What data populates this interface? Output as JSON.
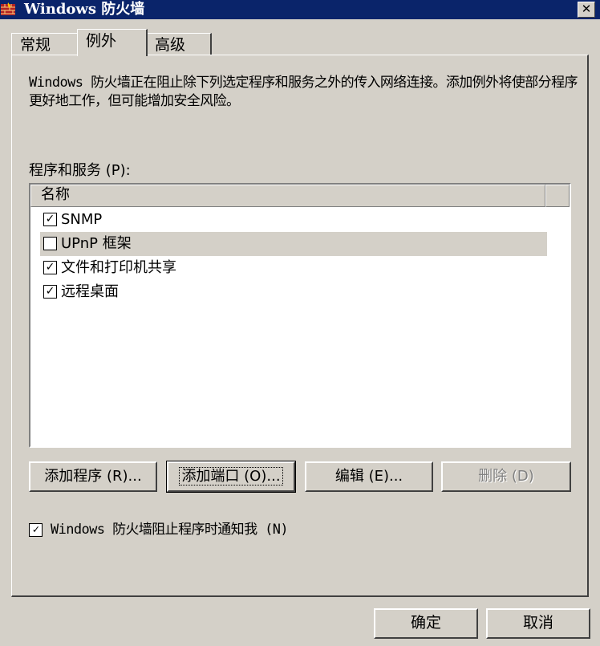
{
  "window": {
    "title": "Windows 防火墙",
    "close_glyph": "✕",
    "icon": "firewall-icon"
  },
  "tabs": [
    {
      "label": "常规",
      "active": false
    },
    {
      "label": "例外",
      "active": true
    },
    {
      "label": "高级",
      "active": false
    }
  ],
  "exceptions": {
    "description": "Windows 防火墙正在阻止除下列选定程序和服务之外的传入网络连接。添加例外将使部分程序更好地工作，但可能增加安全风险。",
    "list_label": "程序和服务 (P):",
    "column_header": "名称",
    "items": [
      {
        "label": "SNMP",
        "checked": true,
        "check_glyph": "✓",
        "selected": false
      },
      {
        "label": "UPnP 框架",
        "checked": false,
        "check_glyph": "",
        "selected": true
      },
      {
        "label": "文件和打印机共享",
        "checked": true,
        "check_glyph": "✓",
        "selected": false
      },
      {
        "label": "远程桌面",
        "checked": true,
        "check_glyph": "✓",
        "selected": false
      }
    ],
    "buttons": {
      "add_program": "添加程序 (R)...",
      "add_port": "添加端口 (O)...",
      "edit": "编辑 (E)...",
      "delete": "删除 (D)"
    },
    "notify_label": "Windows 防火墙阻止程序时通知我 (N)",
    "notify_checked": true,
    "notify_glyph": "✓"
  },
  "footer": {
    "ok": "确定",
    "cancel": "取消"
  }
}
